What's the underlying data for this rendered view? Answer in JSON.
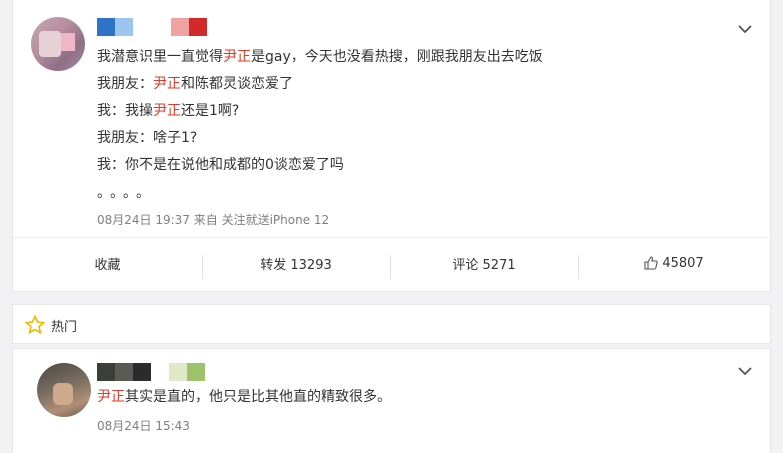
{
  "post": {
    "lines": [
      {
        "pre": "我潜意识里一直觉得",
        "hl": "尹正",
        "post": "是gay，今天也没看热搜，刚跟我朋友出去吃饭"
      },
      {
        "pre": "我朋友：",
        "hl": "尹正",
        "post": "和陈都灵谈恋爱了"
      },
      {
        "pre": "我：我操",
        "hl": "尹正",
        "post": "还是1啊?"
      },
      {
        "pre": "我朋友：啥子1?",
        "hl": "",
        "post": ""
      },
      {
        "pre": "我：你不是在说他和成都的0谈恋爱了吗",
        "hl": "",
        "post": ""
      },
      {
        "pre": "。。。。",
        "hl": "",
        "post": ""
      }
    ],
    "meta": "08月24日 19:37  来自 关注就送iPhone 12",
    "name_colors": [
      "#2f73c8",
      "#9cc6ef",
      "#ffffff",
      "#ffffff",
      "#f0a2a2",
      "#d22a2a"
    ],
    "actions": {
      "favorite": "收藏",
      "repost": "转发 13293",
      "comment": "评论 5271",
      "like": "45807"
    }
  },
  "hot": {
    "label": "热门",
    "star_color": "#f5b400"
  },
  "comment": {
    "hl": "尹正",
    "text": "其实是直的，他只是比其他直的精致很多。",
    "meta": "08月24日 15:43",
    "name_colors": [
      "#3a3f3a",
      "#5b5b55",
      "#2b2b2b",
      "#ffffff",
      "#dfe9c9",
      "#9ec36a"
    ]
  },
  "colors": {
    "highlight": "#e0392b",
    "meta": "#808080"
  }
}
